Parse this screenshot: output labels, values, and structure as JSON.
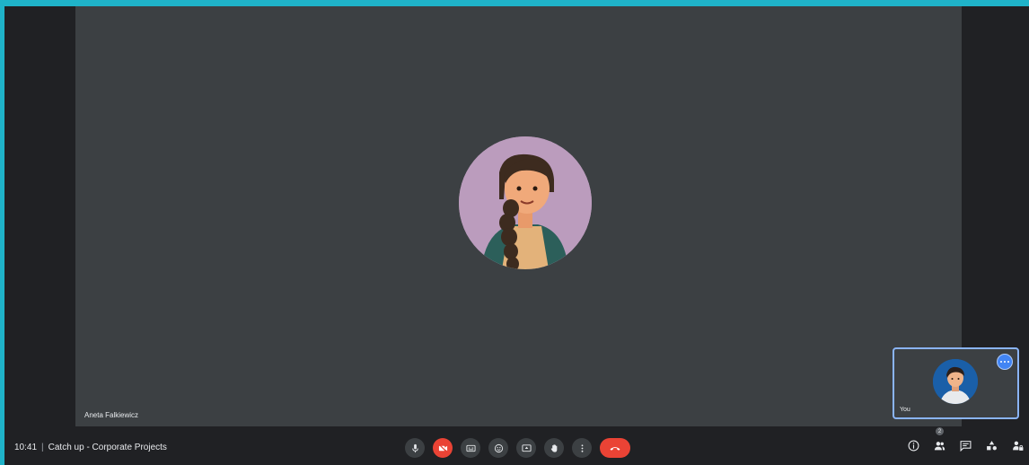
{
  "main_tile": {
    "participant_name": "Aneta Falkiewicz"
  },
  "self_view": {
    "name": "You",
    "more_options_icon": "more-horiz-icon"
  },
  "bottom_bar": {
    "time": "10:41",
    "separator": "|",
    "meeting_title": "Catch up - Corporate Projects",
    "controls": [
      {
        "name": "microphone",
        "icon": "mic-icon"
      },
      {
        "name": "camera-off",
        "icon": "videocam-off-icon",
        "color": "#ea4335"
      },
      {
        "name": "captions",
        "icon": "closed-captions-icon"
      },
      {
        "name": "emoji",
        "icon": "emoji-icon"
      },
      {
        "name": "present",
        "icon": "present-screen-icon"
      },
      {
        "name": "raise-hand",
        "icon": "hand-icon"
      },
      {
        "name": "more-options",
        "icon": "more-vert-icon"
      },
      {
        "name": "leave-call",
        "icon": "call-end-icon",
        "color": "#ea4335"
      }
    ],
    "right_icons": {
      "info": "info-icon",
      "people": "people-icon",
      "people_count": "2",
      "chat": "chat-icon",
      "activities": "activities-icon",
      "host_controls": "lock-person-icon"
    }
  },
  "colors": {
    "accent": "#1fb3c9",
    "tile_background": "#3c4043",
    "app_background": "#202124",
    "danger": "#ea4335",
    "self_highlight": "#8ab4f8"
  }
}
